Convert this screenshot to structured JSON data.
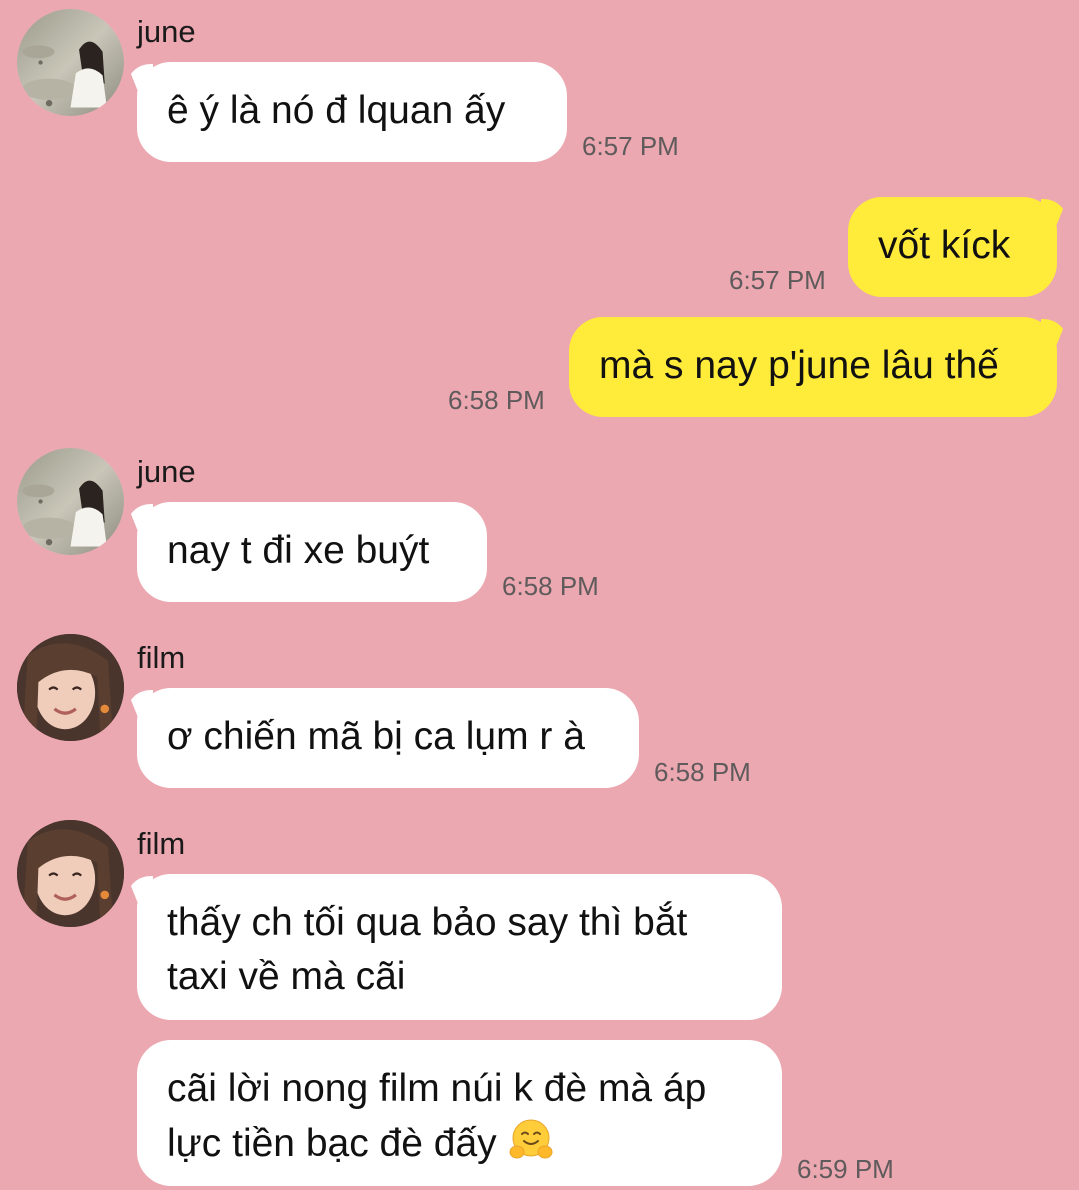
{
  "messages": [
    {
      "sender": "june",
      "text": "ê ý là nó đ lquan ấy",
      "time": "6:57 PM",
      "direction": "incoming"
    },
    {
      "sender": "",
      "text": "vốt kíck",
      "time": "6:57 PM",
      "direction": "outgoing"
    },
    {
      "sender": "",
      "text": "mà s nay p'june lâu thế",
      "time": "6:58 PM",
      "direction": "outgoing"
    },
    {
      "sender": "june",
      "text": "nay t đi xe buýt",
      "time": "6:58 PM",
      "direction": "incoming"
    },
    {
      "sender": "film",
      "text": "ơ chiến mã bị ca lụm r à",
      "time": "6:58 PM",
      "direction": "incoming"
    },
    {
      "sender": "film",
      "text": "thấy ch tối qua bảo say thì bắt taxi về mà cãi",
      "time": "",
      "direction": "incoming"
    },
    {
      "sender": "film",
      "text": "cãi lời nong film núi k đè mà áp lực tiền bạc đè đấy",
      "time": "6:59 PM",
      "direction": "incoming",
      "emoji": "hugging-face-emoji"
    }
  ],
  "colors": {
    "background": "#eca8b1",
    "incoming_bubble": "#ffffff",
    "outgoing_bubble": "#ffeb3a",
    "timestamp": "#5f5a5b"
  },
  "icons": {
    "june_avatar": "june-avatar-photo",
    "film_avatar": "film-avatar-photo",
    "emoji": "hugging-face-emoji"
  }
}
